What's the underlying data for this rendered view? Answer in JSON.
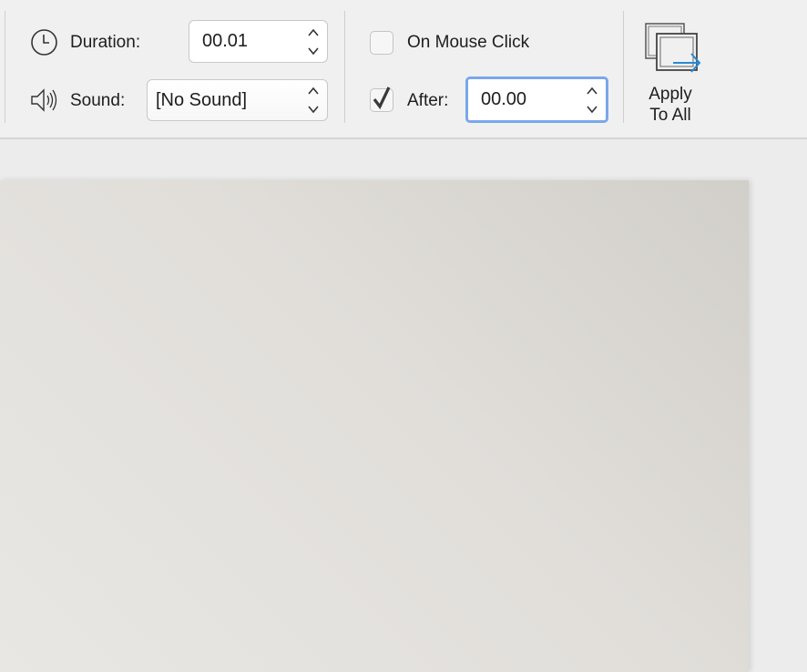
{
  "timing": {
    "duration_label": "Duration:",
    "duration_value": "00.01",
    "sound_label": "Sound:",
    "sound_value": "[No Sound]"
  },
  "advance": {
    "on_mouse_click_label": "On Mouse Click",
    "on_mouse_click_checked": false,
    "after_label": "After:",
    "after_checked": true,
    "after_value": "00.00"
  },
  "apply_to_all": {
    "line1": "Apply",
    "line2": "To All"
  },
  "colors": {
    "focus_ring": "#7aa7ec",
    "arrow_accent": "#2a8ad4"
  }
}
